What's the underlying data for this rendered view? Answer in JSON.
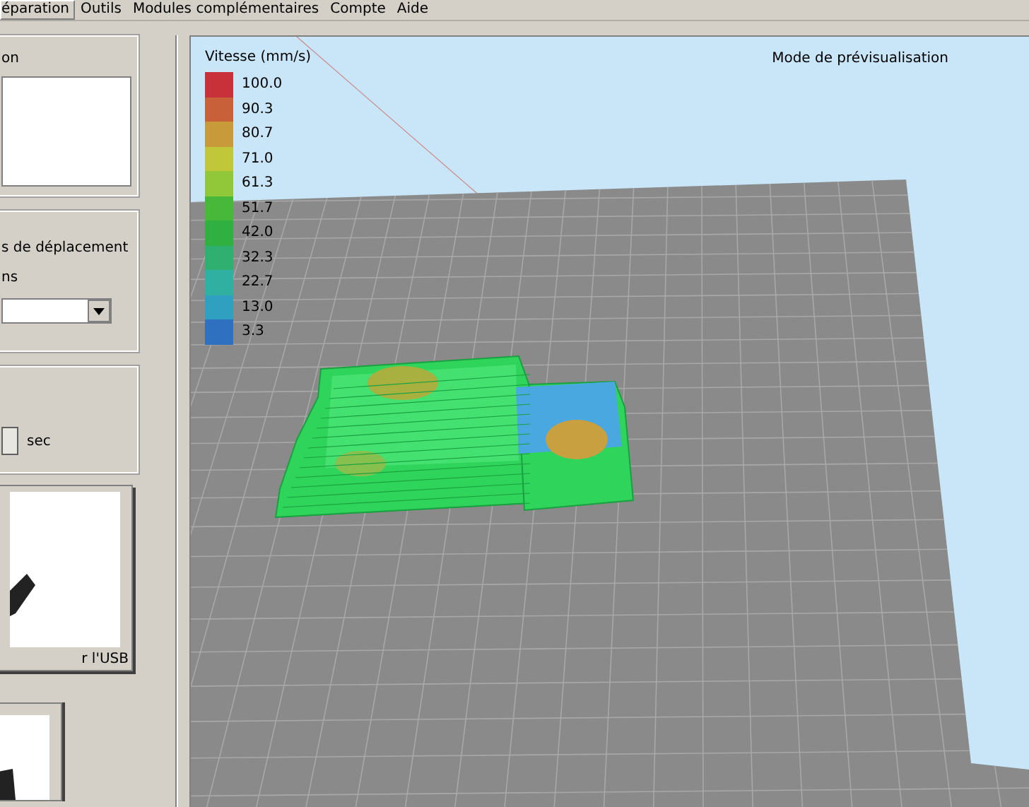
{
  "menu_bar": [
    {
      "label": "éparation",
      "selected": true
    },
    {
      "label": "Outils",
      "selected": false
    },
    {
      "label": "Modules complémentaires",
      "selected": false
    },
    {
      "label": "Compte",
      "selected": false
    },
    {
      "label": "Aide",
      "selected": false
    }
  ],
  "left_panel": {
    "group_1": {
      "label": "on"
    },
    "group_2": {
      "label_1": "s de déplacement",
      "label_2": "ns"
    },
    "group_3": {
      "unit": "sec"
    },
    "usb_button": {
      "label": "r l'USB"
    }
  },
  "viewport": {
    "legend": {
      "title": "Vitesse (mm/s)",
      "items": [
        {
          "label": "100.0",
          "color": "#c8303a"
        },
        {
          "label": "90.3",
          "color": "#c8603a"
        },
        {
          "label": "80.7",
          "color": "#c89a3a"
        },
        {
          "label": "71.0",
          "color": "#c0c83a"
        },
        {
          "label": "61.3",
          "color": "#90c83a"
        },
        {
          "label": "51.7",
          "color": "#48b83a"
        },
        {
          "label": "42.0",
          "color": "#30b040"
        },
        {
          "label": "32.3",
          "color": "#30b070"
        },
        {
          "label": "22.7",
          "color": "#30b0a0"
        },
        {
          "label": "13.0",
          "color": "#30a0c0"
        },
        {
          "label": "3.3",
          "color": "#3070c0"
        }
      ]
    },
    "mode": "Mode de prévisualisation"
  }
}
